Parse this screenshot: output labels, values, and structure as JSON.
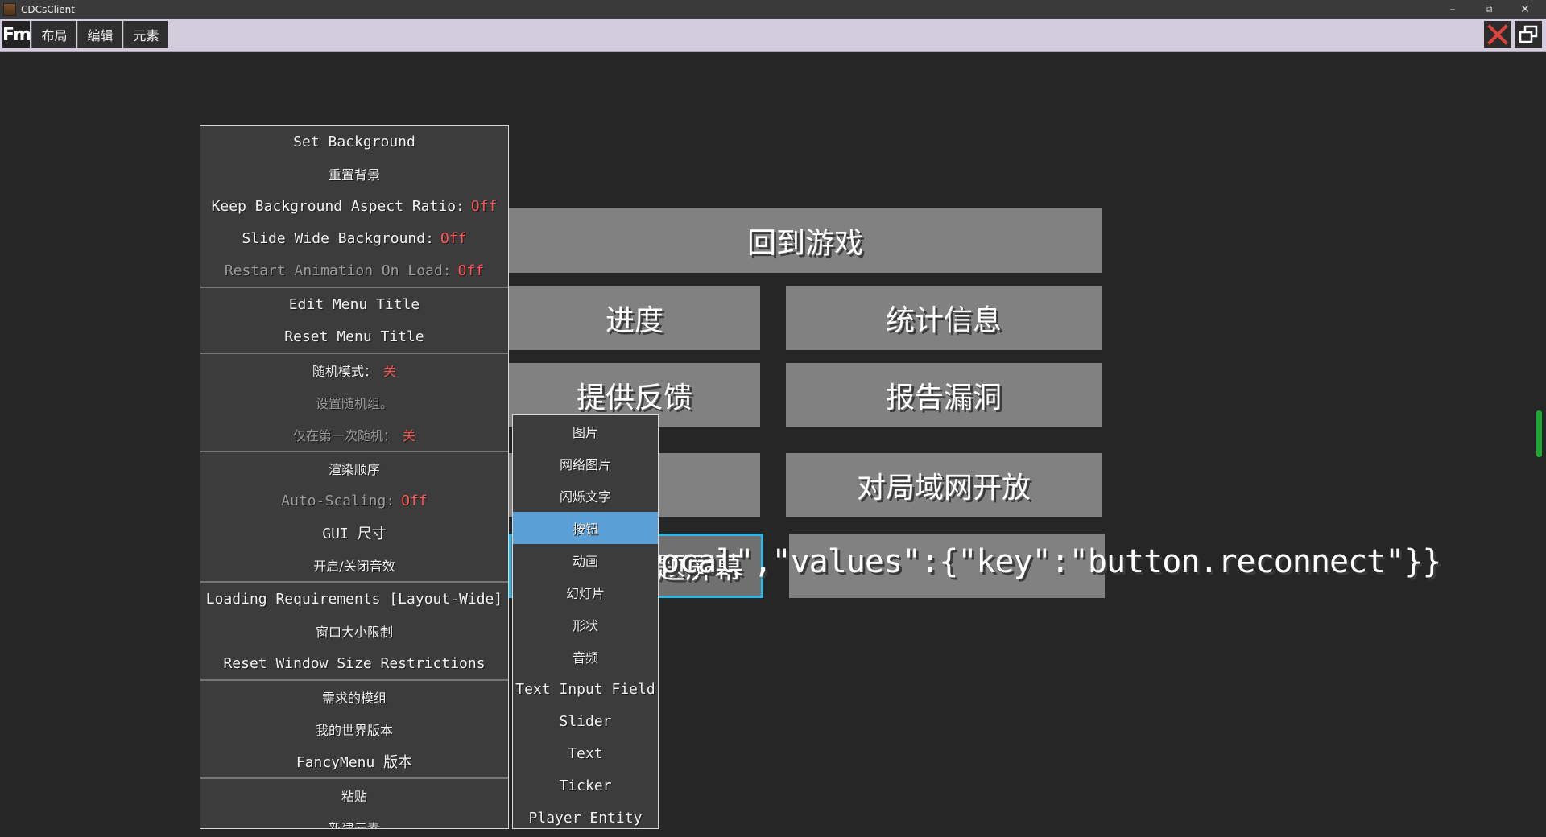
{
  "window": {
    "title": "CDCsClient",
    "minimize": "–",
    "maximize": "⧉",
    "close": "✕"
  },
  "editor_bar": {
    "logo": "Fm",
    "tabs": [
      "布局",
      "编辑",
      "元素"
    ]
  },
  "game_buttons": {
    "back_to_game": "回到游戏",
    "advancements": "进度",
    "statistics": "统计信息",
    "feedback": "提供反馈",
    "report_bugs": "报告漏洞",
    "open_to_lan": "对局域网开放",
    "selected_button": "题屏幕",
    "overflow_text": "ocal\",\"values\":{\"key\":\"button.reconnect\"}}"
  },
  "layout_menu": {
    "items": [
      {
        "label": "Set Background",
        "dim": false,
        "sep": false
      },
      {
        "label": "重置背景",
        "dim": false,
        "sep": false,
        "zh": true
      },
      {
        "label": "Keep Background Aspect Ratio:",
        "value": "Off",
        "dim": false,
        "sep": false
      },
      {
        "label": "Slide Wide Background:",
        "value": "Off",
        "dim": false,
        "sep": false
      },
      {
        "label": "Restart Animation On Load:",
        "value": "Off",
        "dim": true,
        "sep": false
      },
      {
        "label": "Edit Menu Title",
        "dim": false,
        "sep": true
      },
      {
        "label": "Reset Menu Title",
        "dim": false,
        "sep": false
      },
      {
        "label": "随机模式：",
        "value": "关",
        "dim": false,
        "sep": true,
        "zh": true
      },
      {
        "label": "设置随机组。",
        "dim": true,
        "sep": false,
        "zh": true
      },
      {
        "label": "仅在第一次随机：",
        "value": "关",
        "dim": true,
        "sep": false,
        "zh": true
      },
      {
        "label": "渲染顺序",
        "dim": false,
        "sep": true,
        "zh": true
      },
      {
        "label": "Auto-Scaling:",
        "value": "Off",
        "dim": true,
        "sep": false
      },
      {
        "label": "GUI 尺寸",
        "dim": false,
        "sep": false
      },
      {
        "label": "开启/关闭音效",
        "dim": false,
        "sep": false,
        "zh": true
      },
      {
        "label": "Loading Requirements [Layout-Wide]",
        "dim": false,
        "sep": true
      },
      {
        "label": "窗口大小限制",
        "dim": false,
        "sep": false,
        "zh": true
      },
      {
        "label": "Reset Window Size Restrictions",
        "dim": false,
        "sep": false
      },
      {
        "label": "需求的模组",
        "dim": false,
        "sep": true,
        "zh": true
      },
      {
        "label": "我的世界版本",
        "dim": false,
        "sep": false,
        "zh": true
      },
      {
        "label": "FancyMenu 版本",
        "dim": false,
        "sep": false
      },
      {
        "label": "粘贴",
        "dim": false,
        "sep": true,
        "zh": true
      },
      {
        "label": "新建元素",
        "dim": false,
        "sep": false,
        "zh": true
      }
    ]
  },
  "element_menu": {
    "items": [
      {
        "label": "图片",
        "zh": true
      },
      {
        "label": "网络图片",
        "zh": true
      },
      {
        "label": "闪烁文字",
        "zh": true
      },
      {
        "label": "按钮",
        "zh": true,
        "highlight": true
      },
      {
        "label": "动画",
        "zh": true
      },
      {
        "label": "幻灯片",
        "zh": true
      },
      {
        "label": "形状",
        "zh": true
      },
      {
        "label": "音频",
        "zh": true
      },
      {
        "label": "Text Input Field"
      },
      {
        "label": "Slider"
      },
      {
        "label": "Text"
      },
      {
        "label": "Ticker"
      },
      {
        "label": "Player Entity"
      }
    ]
  },
  "colors": {
    "off_value": "#ff5555",
    "highlight": "#5a9fd6",
    "selection_border": "#2eb7e3",
    "editor_bar": "#d3ccdc",
    "close_icon": "#e0433a"
  }
}
